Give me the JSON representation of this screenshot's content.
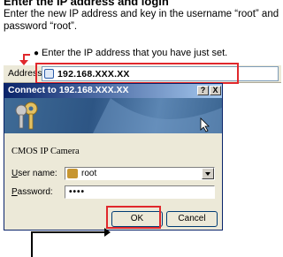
{
  "page": {
    "heading": "Enter the IP address and login",
    "instruction": "Enter the new IP address and key in the username “root” and password “root”.",
    "note": "Enter the IP address that you have just set."
  },
  "browser": {
    "address_label": "Address",
    "address_value": "192.168.XXX.XX"
  },
  "dialog": {
    "title": "Connect to 192.168.XXX.XX",
    "help_label": "?",
    "close_label": "X",
    "realm": "CMOS IP Camera",
    "username_label_accel": "U",
    "username_label_rest": "ser name:",
    "username_value": "root",
    "password_label_accel": "P",
    "password_label_rest": "assword:",
    "password_value": "••••",
    "ok_label": "OK",
    "cancel_label": "Cancel"
  },
  "colors": {
    "highlight": "#e0282c",
    "title_start": "#0a246a"
  },
  "icons": [
    "keys-icon",
    "user-icon",
    "computer-icon",
    "ie-page-icon",
    "mouse-cursor-icon"
  ]
}
